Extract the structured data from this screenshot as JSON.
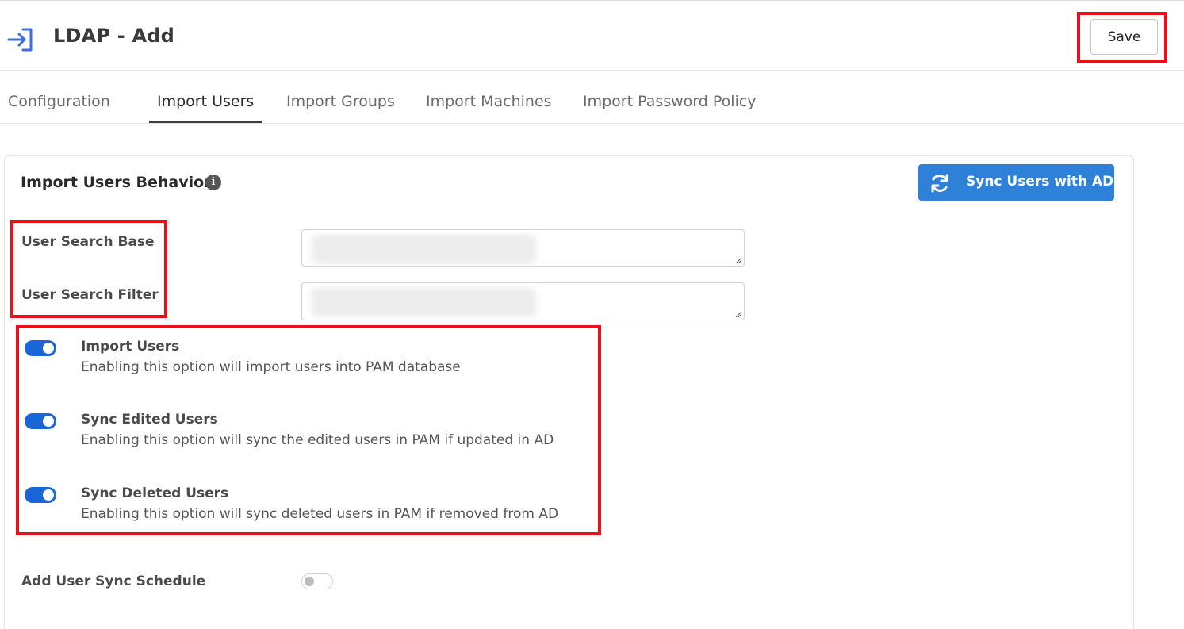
{
  "header": {
    "title": "LDAP - Add",
    "save_label": "Save",
    "icon": "login-icon"
  },
  "tabs": [
    {
      "label": "Configuration",
      "active": false
    },
    {
      "label": "Import Users",
      "active": true
    },
    {
      "label": "Import Groups",
      "active": false
    },
    {
      "label": "Import Machines",
      "active": false
    },
    {
      "label": "Import Password Policy",
      "active": false
    }
  ],
  "card": {
    "title": "Import Users Behavior",
    "sync_button_label": "Sync Users with AD",
    "fields": [
      {
        "label": "User Search Base",
        "value": ""
      },
      {
        "label": "User Search Filter",
        "value": ""
      }
    ],
    "options": [
      {
        "title": "Import Users",
        "description": "Enabling this option will import users into PAM database",
        "enabled": true
      },
      {
        "title": "Sync Edited Users",
        "description": "Enabling this option will sync the edited users in PAM if updated in AD",
        "enabled": true
      },
      {
        "title": "Sync Deleted Users",
        "description": "Enabling this option will sync deleted users in PAM if removed from AD",
        "enabled": true
      }
    ],
    "schedule": {
      "label": "Add User Sync Schedule",
      "enabled": false
    }
  },
  "colors": {
    "accent": "#2f80d8",
    "toggle_on": "#1a66d8",
    "highlight": "#e8101a"
  }
}
